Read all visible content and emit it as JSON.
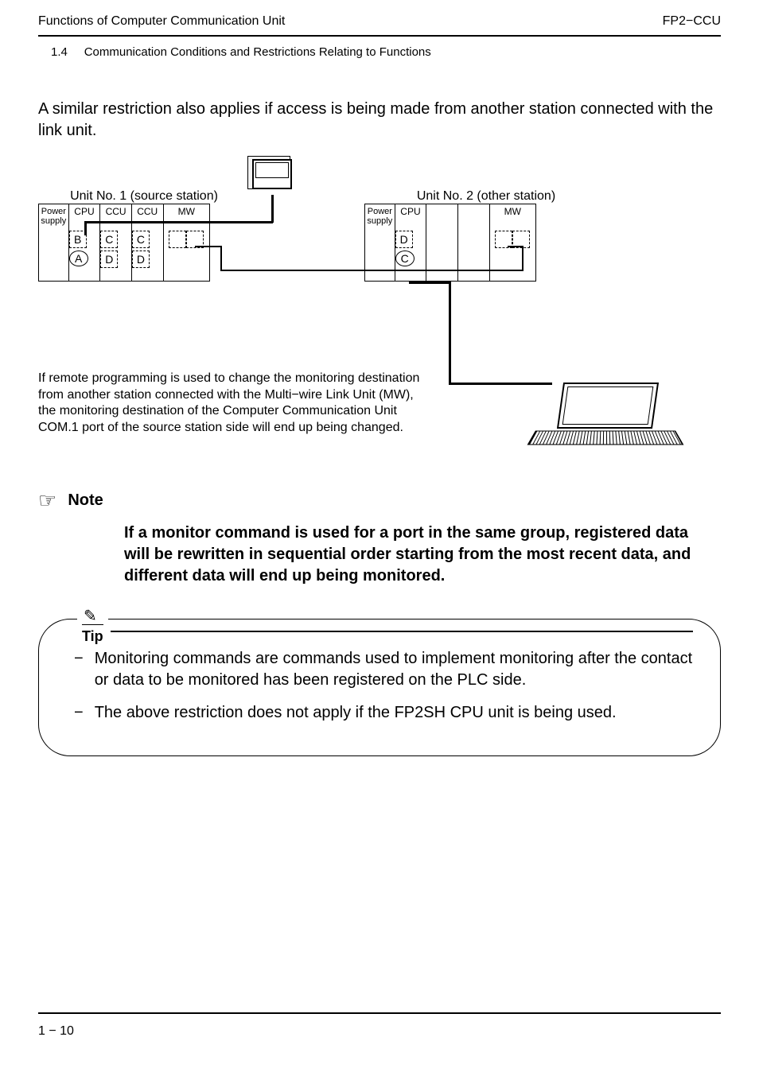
{
  "header": {
    "left": "Functions of Computer Communication Unit",
    "right": "FP2−CCU"
  },
  "subheader": {
    "num": "1.4",
    "title": "Communication Conditions and Restrictions Relating to Functions"
  },
  "intro": "A similar restriction also applies if access is being made from another station connected with the link unit.",
  "diagram": {
    "unit1": {
      "label": "Unit No. 1 (source station)",
      "slots": [
        {
          "label": "Power supply",
          "marks": []
        },
        {
          "label": "CPU",
          "marks": [
            {
              "type": "box",
              "t": "B"
            },
            {
              "type": "oval",
              "t": "A"
            }
          ]
        },
        {
          "label": "CCU",
          "marks": [
            {
              "type": "box",
              "t": "C"
            },
            {
              "type": "box",
              "t": "D"
            }
          ]
        },
        {
          "label": "CCU",
          "marks": [
            {
              "type": "box",
              "t": "C"
            },
            {
              "type": "box",
              "t": "D"
            }
          ]
        },
        {
          "label": "MW",
          "marks": [
            {
              "type": "box",
              "t": ""
            },
            {
              "type": "box",
              "t": ""
            }
          ]
        }
      ]
    },
    "unit2": {
      "label": "Unit No. 2 (other station)",
      "slots": [
        {
          "label": "Power supply",
          "marks": []
        },
        {
          "label": "CPU",
          "marks": [
            {
              "type": "box",
              "t": "D"
            },
            {
              "type": "oval",
              "t": "C"
            }
          ]
        },
        {
          "label": "",
          "marks": []
        },
        {
          "label": "",
          "marks": []
        },
        {
          "label": "MW",
          "marks": [
            {
              "type": "box",
              "t": ""
            },
            {
              "type": "box",
              "t": ""
            }
          ]
        }
      ]
    },
    "caption": "If remote programming is used to change the monitoring destination from another station connected with the Multi−wire Link Unit (MW), the monitoring destination of the Computer Communication Unit COM.1 port of the source station side will end up being changed."
  },
  "note": {
    "title": "Note",
    "body": "If a monitor command is used for a port in the same group, registered data will be rewritten in sequential order starting from the most recent data, and different data will end up being monitored."
  },
  "tip": {
    "title": "Tip",
    "items": [
      "Monitoring commands are commands used to implement monitoring after the contact or data to be monitored has been registered on the PLC side.",
      "The above restriction does not apply if the FP2SH CPU unit is being used."
    ]
  },
  "footer": {
    "page": "1 − 10"
  }
}
